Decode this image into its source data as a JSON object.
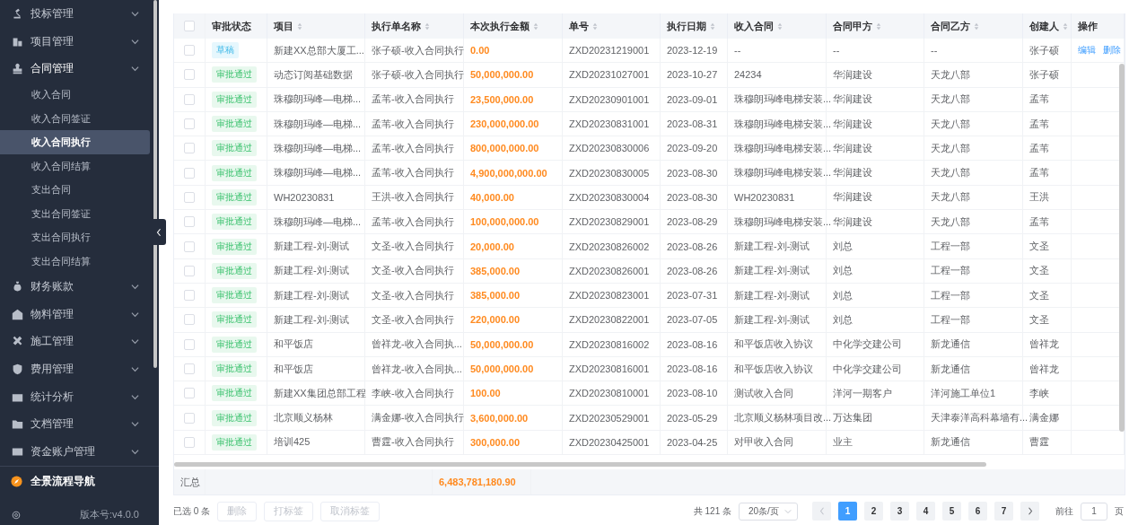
{
  "sidebar": {
    "items": [
      {
        "label": "投标管理",
        "expanded": false
      },
      {
        "label": "项目管理",
        "expanded": false
      },
      {
        "label": "合同管理",
        "expanded": true,
        "children": [
          {
            "label": "收入合同",
            "selected": false
          },
          {
            "label": "收入合同签证",
            "selected": false
          },
          {
            "label": "收入合同执行",
            "selected": true
          },
          {
            "label": "收入合同结算",
            "selected": false
          },
          {
            "label": "支出合同",
            "selected": false
          },
          {
            "label": "支出合同签证",
            "selected": false
          },
          {
            "label": "支出合同执行",
            "selected": false
          },
          {
            "label": "支出合同结算",
            "selected": false
          }
        ]
      },
      {
        "label": "财务账款",
        "expanded": false
      },
      {
        "label": "物料管理",
        "expanded": false
      },
      {
        "label": "施工管理",
        "expanded": false
      },
      {
        "label": "费用管理",
        "expanded": false
      },
      {
        "label": "统计分析",
        "expanded": false
      },
      {
        "label": "文档管理",
        "expanded": false
      },
      {
        "label": "资金账户管理",
        "expanded": false
      }
    ],
    "nav_link": "全景流程导航",
    "version": "版本号:v4.0.0"
  },
  "table": {
    "header_checked": false,
    "columns": [
      {
        "label": "审批状态",
        "sortable": false
      },
      {
        "label": "项目",
        "sortable": true
      },
      {
        "label": "执行单名称",
        "sortable": true
      },
      {
        "label": "本次执行金额",
        "sortable": true
      },
      {
        "label": "单号",
        "sortable": true
      },
      {
        "label": "执行日期",
        "sortable": true
      },
      {
        "label": "收入合同",
        "sortable": true
      },
      {
        "label": "合同甲方",
        "sortable": true
      },
      {
        "label": "合同乙方",
        "sortable": true
      },
      {
        "label": "创建人",
        "sortable": true
      },
      {
        "label": "操作",
        "sortable": false
      }
    ],
    "rows": [
      {
        "checked": false,
        "kind": "draft",
        "cells": [
          "草稿",
          "新建XX总部大厦工...",
          "张子硕-收入合同执行",
          "0.00",
          "ZXD20231219001",
          "2023-12-19",
          "--",
          "--",
          "--",
          "张子硕"
        ],
        "actions": [
          "编辑",
          "删除"
        ]
      },
      {
        "checked": false,
        "kind": "approved",
        "cells": [
          "审批通过",
          "动态订阅基础数据",
          "张子硕-收入合同执行",
          "50,000,000.00",
          "ZXD20231027001",
          "2023-10-27",
          "24234",
          "华润建设",
          "天龙八部",
          "张子硕"
        ]
      },
      {
        "checked": false,
        "kind": "approved",
        "cells": [
          "审批通过",
          "珠穆朗玛峰—电梯...",
          "孟苇-收入合同执行",
          "23,500,000.00",
          "ZXD20230901001",
          "2023-09-01",
          "珠穆朗玛峰电梯安装...",
          "华润建设",
          "天龙八部",
          "孟苇"
        ]
      },
      {
        "checked": false,
        "kind": "approved",
        "cells": [
          "审批通过",
          "珠穆朗玛峰—电梯...",
          "孟苇-收入合同执行",
          "230,000,000.00",
          "ZXD20230831001",
          "2023-08-31",
          "珠穆朗玛峰电梯安装...",
          "华润建设",
          "天龙八部",
          "孟苇"
        ]
      },
      {
        "checked": false,
        "kind": "approved",
        "cells": [
          "审批通过",
          "珠穆朗玛峰—电梯...",
          "孟苇-收入合同执行",
          "800,000,000.00",
          "ZXD20230830006",
          "2023-09-20",
          "珠穆朗玛峰电梯安装...",
          "华润建设",
          "天龙八部",
          "孟苇"
        ]
      },
      {
        "checked": false,
        "kind": "approved",
        "cells": [
          "审批通过",
          "珠穆朗玛峰—电梯...",
          "孟苇-收入合同执行",
          "4,900,000,000.00",
          "ZXD20230830005",
          "2023-08-30",
          "珠穆朗玛峰电梯安装...",
          "华润建设",
          "天龙八部",
          "孟苇"
        ]
      },
      {
        "checked": false,
        "kind": "approved",
        "cells": [
          "审批通过",
          "WH20230831",
          "王洪-收入合同执行",
          "40,000.00",
          "ZXD20230830004",
          "2023-08-30",
          "WH20230831",
          "华润建设",
          "天龙八部",
          "王洪"
        ]
      },
      {
        "checked": false,
        "kind": "approved",
        "cells": [
          "审批通过",
          "珠穆朗玛峰—电梯...",
          "孟苇-收入合同执行",
          "100,000,000.00",
          "ZXD20230829001",
          "2023-08-29",
          "珠穆朗玛峰电梯安装...",
          "华润建设",
          "天龙八部",
          "孟苇"
        ]
      },
      {
        "checked": false,
        "kind": "approved",
        "cells": [
          "审批通过",
          "新建工程-刘-测试",
          "文圣-收入合同执行",
          "20,000.00",
          "ZXD20230826002",
          "2023-08-26",
          "新建工程-刘-测试",
          "刘总",
          "工程一部",
          "文圣"
        ]
      },
      {
        "checked": false,
        "kind": "approved",
        "cells": [
          "审批通过",
          "新建工程-刘-测试",
          "文圣-收入合同执行",
          "385,000.00",
          "ZXD20230826001",
          "2023-08-26",
          "新建工程-刘-测试",
          "刘总",
          "工程一部",
          "文圣"
        ]
      },
      {
        "checked": false,
        "kind": "approved",
        "cells": [
          "审批通过",
          "新建工程-刘-测试",
          "文圣-收入合同执行",
          "385,000.00",
          "ZXD20230823001",
          "2023-07-31",
          "新建工程-刘-测试",
          "刘总",
          "工程一部",
          "文圣"
        ]
      },
      {
        "checked": false,
        "kind": "approved",
        "cells": [
          "审批通过",
          "新建工程-刘-测试",
          "文圣-收入合同执行",
          "220,000.00",
          "ZXD20230822001",
          "2023-07-05",
          "新建工程-刘-测试",
          "刘总",
          "工程一部",
          "文圣"
        ]
      },
      {
        "checked": false,
        "kind": "approved",
        "cells": [
          "审批通过",
          "和平饭店",
          "曾祥龙-收入合同执...",
          "50,000,000.00",
          "ZXD20230816002",
          "2023-08-16",
          "和平饭店收入协议",
          "中化学交建公司",
          "新龙通信",
          "曾祥龙"
        ]
      },
      {
        "checked": false,
        "kind": "approved",
        "cells": [
          "审批通过",
          "和平饭店",
          "曾祥龙-收入合同执...",
          "50,000,000.00",
          "ZXD20230816001",
          "2023-08-16",
          "和平饭店收入协议",
          "中化学交建公司",
          "新龙通信",
          "曾祥龙"
        ]
      },
      {
        "checked": false,
        "kind": "approved",
        "cells": [
          "审批通过",
          "新建XX集团总部工程",
          "李峡-收入合同执行",
          "100.00",
          "ZXD20230810001",
          "2023-08-10",
          "测试收入合同",
          "洋河一期客户",
          "洋河施工单位1",
          "李峡"
        ]
      },
      {
        "checked": false,
        "kind": "approved",
        "cells": [
          "审批通过",
          "北京顺义杨林",
          "满金娜-收入合同执行",
          "3,600,000.00",
          "ZXD20230529001",
          "2023-05-29",
          "北京顺义杨林项目改...",
          "万达集团",
          "天津泰洋高科幕墙有...",
          "满金娜"
        ]
      },
      {
        "checked": false,
        "kind": "approved",
        "cells": [
          "审批通过",
          "培训425",
          "曹霆-收入合同执行",
          "300,000.00",
          "ZXD20230425001",
          "2023-04-25",
          "对甲收入合同",
          "业主",
          "新龙通信",
          "曹霆"
        ]
      }
    ],
    "summary": {
      "label": "汇总",
      "amount": "6,483,781,180.90"
    }
  },
  "footer": {
    "selected_count": "已选 0 条",
    "buttons": [
      {
        "label": "删除",
        "disabled": true
      },
      {
        "label": "打标签",
        "disabled": true
      },
      {
        "label": "取消标签",
        "disabled": true
      }
    ],
    "total": "共 121 条",
    "page_size": "20条/页",
    "pages": [
      {
        "label": "1",
        "selected": true
      },
      {
        "label": "2",
        "selected": false
      },
      {
        "label": "3",
        "selected": false
      },
      {
        "label": "4",
        "selected": false
      },
      {
        "label": "5",
        "selected": false
      },
      {
        "label": "6",
        "selected": false
      },
      {
        "label": "7",
        "selected": false
      }
    ],
    "goto_label": "前往",
    "goto_value": "1",
    "goto_suffix": "页"
  }
}
